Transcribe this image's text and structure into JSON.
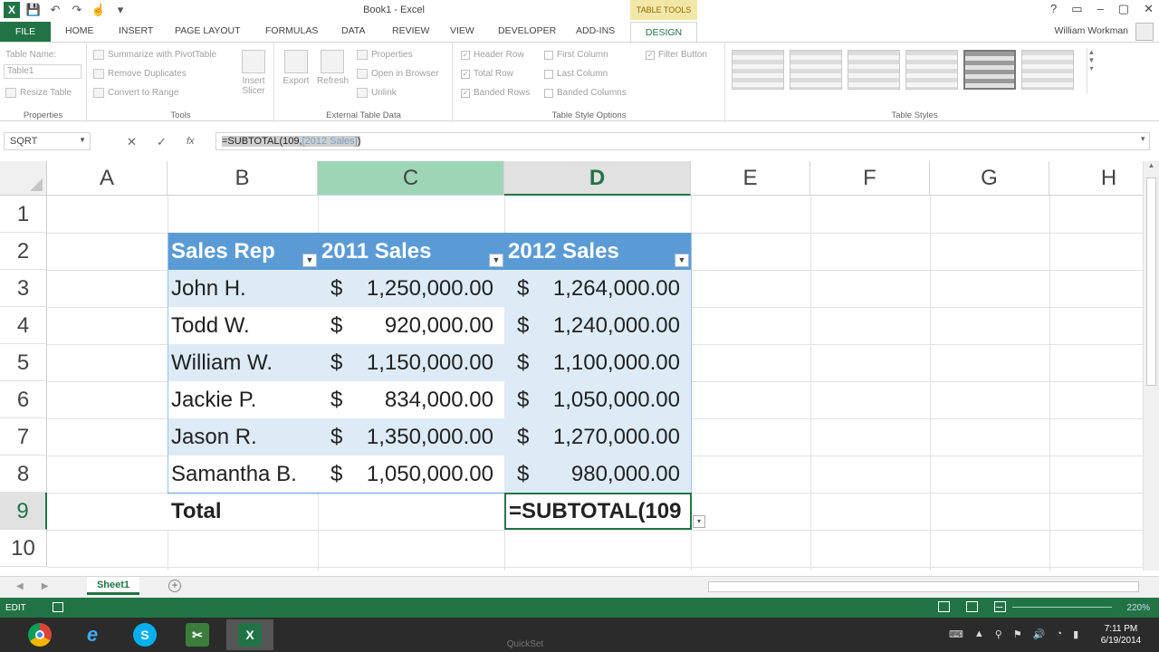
{
  "window": {
    "title": "Book1 - Excel",
    "context_tab_group": "TABLE TOOLS",
    "controls": [
      "?",
      "▭",
      "–",
      "▢",
      "✕"
    ],
    "user": "William Workman"
  },
  "tabs": [
    "FILE",
    "HOME",
    "INSERT",
    "PAGE LAYOUT",
    "FORMULAS",
    "DATA",
    "REVIEW",
    "VIEW",
    "DEVELOPER",
    "ADD-INS",
    "DESIGN"
  ],
  "ribbon": {
    "properties": {
      "label": "Properties",
      "table_name_label": "Table Name:",
      "table_name_value": "Table1",
      "resize": "Resize Table"
    },
    "tools": {
      "label": "Tools",
      "summarize": "Summarize with PivotTable",
      "remove_dups": "Remove Duplicates",
      "convert": "Convert to Range",
      "insert_slicer_1": "Insert",
      "insert_slicer_2": "Slicer"
    },
    "external": {
      "label": "External Table Data",
      "export": "Export",
      "refresh": "Refresh",
      "properties": "Properties",
      "open_browser": "Open in Browser",
      "unlink": "Unlink"
    },
    "style_options": {
      "label": "Table Style Options",
      "header_row": "Header Row",
      "total_row": "Total Row",
      "banded_rows": "Banded Rows",
      "first_column": "First Column",
      "last_column": "Last Column",
      "banded_columns": "Banded Columns",
      "filter_button": "Filter Button"
    },
    "styles": {
      "label": "Table Styles"
    }
  },
  "formula_bar": {
    "name_box": "SQRT",
    "cancel": "✕",
    "enter": "✓",
    "fx": "fx",
    "formula_fn": "=SUBTOTAL(109,",
    "formula_ref": "[2012 Sales]",
    "formula_end": ")"
  },
  "grid": {
    "columns": [
      "A",
      "B",
      "C",
      "D",
      "E",
      "F",
      "G",
      "H"
    ],
    "rows": [
      "1",
      "2",
      "3",
      "4",
      "5",
      "6",
      "7",
      "8",
      "9",
      "10"
    ],
    "table": {
      "headers": [
        "Sales Rep",
        "2011 Sales",
        "2012 Sales"
      ],
      "rows": [
        {
          "rep": "John H.",
          "s2011": "1,250,000.00",
          "s2012": "1,264,000.00"
        },
        {
          "rep": "Todd W.",
          "s2011": "920,000.00",
          "s2012": "1,240,000.00"
        },
        {
          "rep": "William W.",
          "s2011": "1,150,000.00",
          "s2012": "1,100,000.00"
        },
        {
          "rep": "Jackie P.",
          "s2011": "834,000.00",
          "s2012": "1,050,000.00"
        },
        {
          "rep": "Jason R.",
          "s2011": "1,350,000.00",
          "s2012": "1,270,000.00"
        },
        {
          "rep": "Samantha B.",
          "s2011": "1,050,000.00",
          "s2012": "980,000.00"
        }
      ],
      "currency": "$",
      "total_label": "Total",
      "total_formula": "=SUBTOTAL(109"
    }
  },
  "sheets": {
    "active": "Sheet1",
    "add": "+"
  },
  "status": {
    "mode": "EDIT",
    "zoom": "220%"
  },
  "taskbar": {
    "time": "7:11 PM",
    "date": "6/19/2014",
    "hidden_app": "QuickSet"
  }
}
